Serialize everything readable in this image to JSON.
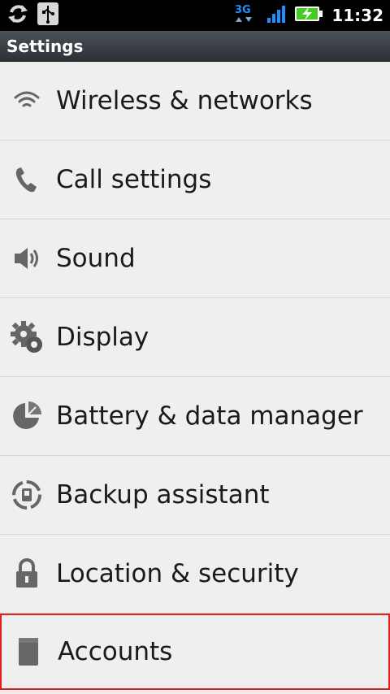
{
  "status_bar": {
    "time": "11:32",
    "network": "3G",
    "icons": [
      "sync-icon",
      "usb-icon",
      "3g-icon",
      "signal-icon",
      "battery-charging-icon"
    ]
  },
  "title_bar": {
    "title": "Settings"
  },
  "settings_items": [
    {
      "label": "Wireless & networks",
      "icon": "wifi-icon"
    },
    {
      "label": "Call settings",
      "icon": "phone-icon"
    },
    {
      "label": "Sound",
      "icon": "speaker-icon"
    },
    {
      "label": "Display",
      "icon": "gear-icon"
    },
    {
      "label": "Battery & data manager",
      "icon": "pie-chart-icon"
    },
    {
      "label": "Backup assistant",
      "icon": "backup-icon"
    },
    {
      "label": "Location & security",
      "icon": "lock-icon"
    },
    {
      "label": "Accounts",
      "icon": "account-icon",
      "selected": true
    }
  ],
  "colors": {
    "selection_border": "#e02020",
    "status_bar_bg": "#000000",
    "accent_blue": "#1e90ff"
  }
}
